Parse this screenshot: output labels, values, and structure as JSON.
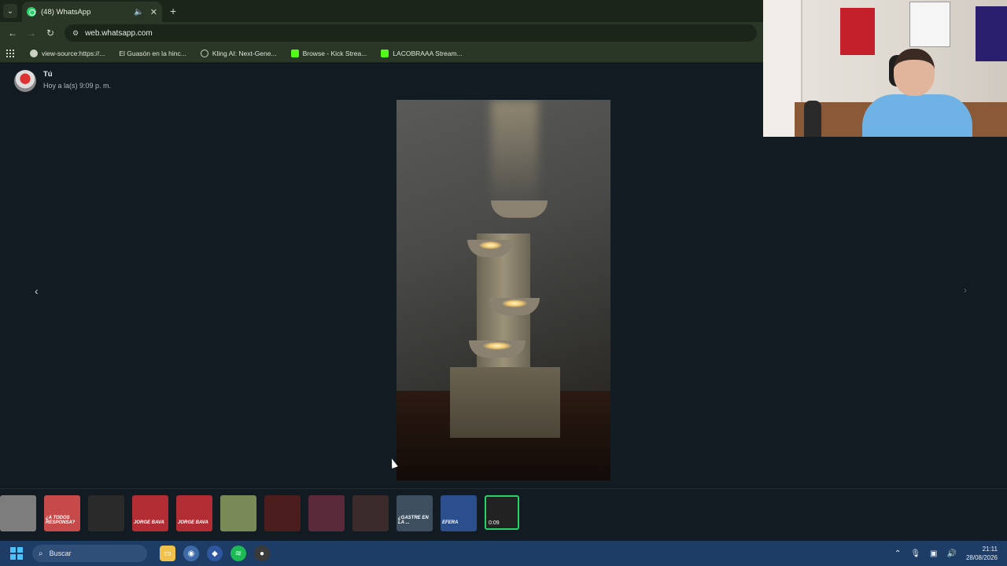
{
  "browser": {
    "tab": {
      "title": "(48) WhatsApp"
    },
    "address": {
      "url": "web.whatsapp.com"
    },
    "bookmarks": [
      {
        "label": "view-source:https://...",
        "icon": "globe-icon"
      },
      {
        "label": "El Guasón en la hinc...",
        "icon": "video-icon"
      },
      {
        "label": "Kling AI: Next-Gene...",
        "icon": "kling-icon"
      },
      {
        "label": "Browse - Kick Strea...",
        "icon": "kick-icon"
      },
      {
        "label": "LACOBRAAA Stream...",
        "icon": "kick-icon"
      }
    ]
  },
  "viewer": {
    "sender": {
      "name": "Tú",
      "time": "Hoy a la(s) 9:09 p. m."
    },
    "media": {
      "type": "video",
      "subject": "illuminated tiered fountain"
    },
    "thumbnails": [
      {
        "overlay": "",
        "color": "#7d7d7d"
      },
      {
        "overlay": "¿A TODOS RESPONSA?",
        "color": "#c64a4a"
      },
      {
        "overlay": "",
        "color": "#2a2a2a"
      },
      {
        "overlay": "JORGE BAVA",
        "color": "#b22c33"
      },
      {
        "overlay": "JORGE BAVA",
        "color": "#b22c33"
      },
      {
        "overlay": "",
        "color": "#7a8a56"
      },
      {
        "overlay": "",
        "color": "#4b1d1d"
      },
      {
        "overlay": "",
        "color": "#5a2a3a"
      },
      {
        "overlay": "",
        "color": "#3b2b2b"
      },
      {
        "overlay": "¿GASTRE EN LA ...",
        "color": "#3d4e5e"
      },
      {
        "overlay": "EFERA",
        "color": "#2b4f8c"
      },
      {
        "overlay": "",
        "color": "#252520",
        "selected": true,
        "duration": "0:09"
      }
    ]
  },
  "taskbar": {
    "search_placeholder": "Buscar",
    "time": "21:11",
    "date": "28/08/2026"
  },
  "colors": {
    "accent": "#25d366",
    "taskbar": "#1d3d66",
    "browser_chrome": "#2b3726"
  }
}
